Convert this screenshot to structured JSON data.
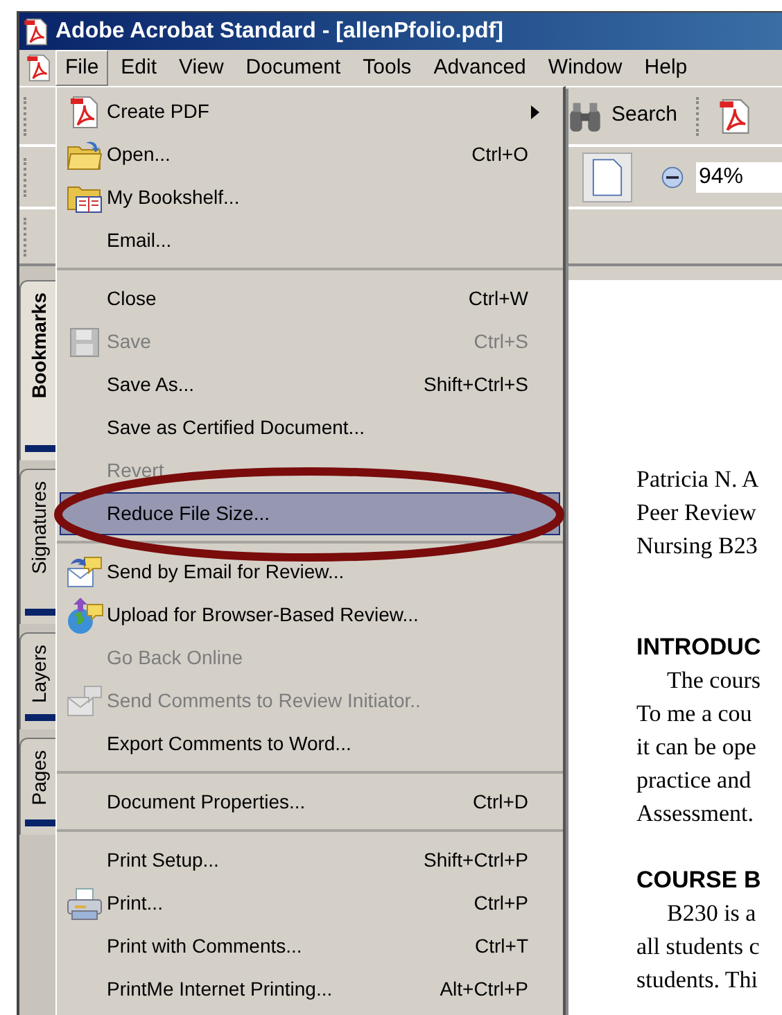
{
  "window": {
    "title": "Adobe Acrobat Standard - [allenPfolio.pdf]"
  },
  "menu_bar": [
    {
      "label": "File",
      "selected": true
    },
    {
      "label": "Edit",
      "selected": false
    },
    {
      "label": "View",
      "selected": false
    },
    {
      "label": "Document",
      "selected": false
    },
    {
      "label": "Tools",
      "selected": false
    },
    {
      "label": "Advanced",
      "selected": false
    },
    {
      "label": "Window",
      "selected": false
    },
    {
      "label": "Help",
      "selected": false
    }
  ],
  "toolbar": {
    "search_label": "Search",
    "zoom": "94%"
  },
  "side_tabs": [
    {
      "label": "Bookmarks",
      "selected": true
    },
    {
      "label": "Signatures",
      "selected": false
    },
    {
      "label": "Layers",
      "selected": false
    },
    {
      "label": "Pages",
      "selected": false
    }
  ],
  "file_menu": {
    "groups": [
      [
        {
          "label": "Create PDF",
          "submenu": true,
          "disabled": false,
          "selected": false
        },
        {
          "label": "Open...",
          "shortcut": "Ctrl+O",
          "submenu": false,
          "disabled": false,
          "selected": false
        },
        {
          "label": "My Bookshelf...",
          "submenu": false,
          "disabled": false,
          "selected": false
        },
        {
          "label": "Email...",
          "submenu": false,
          "disabled": false,
          "selected": false
        }
      ],
      [
        {
          "label": "Close",
          "shortcut": "Ctrl+W",
          "submenu": false,
          "disabled": false,
          "selected": false
        },
        {
          "label": "Save",
          "shortcut": "Ctrl+S",
          "submenu": false,
          "disabled": true,
          "selected": false
        },
        {
          "label": "Save As...",
          "shortcut": "Shift+Ctrl+S",
          "submenu": false,
          "disabled": false,
          "selected": false
        },
        {
          "label": "Save as Certified Document...",
          "submenu": false,
          "disabled": false,
          "selected": false
        },
        {
          "label": "Revert",
          "submenu": false,
          "disabled": true,
          "selected": false
        },
        {
          "label": "Reduce File Size...",
          "submenu": false,
          "disabled": false,
          "selected": true
        }
      ],
      [
        {
          "label": "Send by Email for Review...",
          "submenu": false,
          "disabled": false,
          "selected": false
        },
        {
          "label": "Upload for Browser-Based Review...",
          "submenu": false,
          "disabled": false,
          "selected": false
        },
        {
          "label": "Go Back Online",
          "submenu": false,
          "disabled": true,
          "selected": false
        },
        {
          "label": "Send Comments to Review Initiator..",
          "submenu": false,
          "disabled": true,
          "selected": false
        },
        {
          "label": "Export Comments to Word...",
          "submenu": false,
          "disabled": false,
          "selected": false
        }
      ],
      [
        {
          "label": "Document Properties...",
          "shortcut": "Ctrl+D",
          "submenu": false,
          "disabled": false,
          "selected": false
        }
      ],
      [
        {
          "label": "Print Setup...",
          "shortcut": "Shift+Ctrl+P",
          "submenu": false,
          "disabled": false,
          "selected": false
        },
        {
          "label": "Print...",
          "shortcut": "Ctrl+P",
          "submenu": false,
          "disabled": false,
          "selected": false
        },
        {
          "label": "Print with Comments...",
          "shortcut": "Ctrl+T",
          "submenu": false,
          "disabled": false,
          "selected": false
        },
        {
          "label": "PrintMe Internet Printing...",
          "shortcut": "Alt+Ctrl+P",
          "submenu": false,
          "disabled": false,
          "selected": false
        }
      ]
    ]
  },
  "document": {
    "lines": [
      {
        "kind": "body",
        "text": "Patricia N. A"
      },
      {
        "kind": "body",
        "text": "Peer Review"
      },
      {
        "kind": "body",
        "text": "Nursing B23"
      },
      {
        "kind": "heading",
        "text": "INTRODUC"
      },
      {
        "kind": "indent",
        "text": "The cours"
      },
      {
        "kind": "body",
        "text": "To me a cou"
      },
      {
        "kind": "body",
        "text": "it can be ope"
      },
      {
        "kind": "body",
        "text": "practice and"
      },
      {
        "kind": "body",
        "text": "Assessment."
      },
      {
        "kind": "heading",
        "text": "COURSE B"
      },
      {
        "kind": "indent",
        "text": "B230 is a"
      },
      {
        "kind": "body",
        "text": "all students c"
      },
      {
        "kind": "body",
        "text": "students. Thi"
      }
    ]
  }
}
